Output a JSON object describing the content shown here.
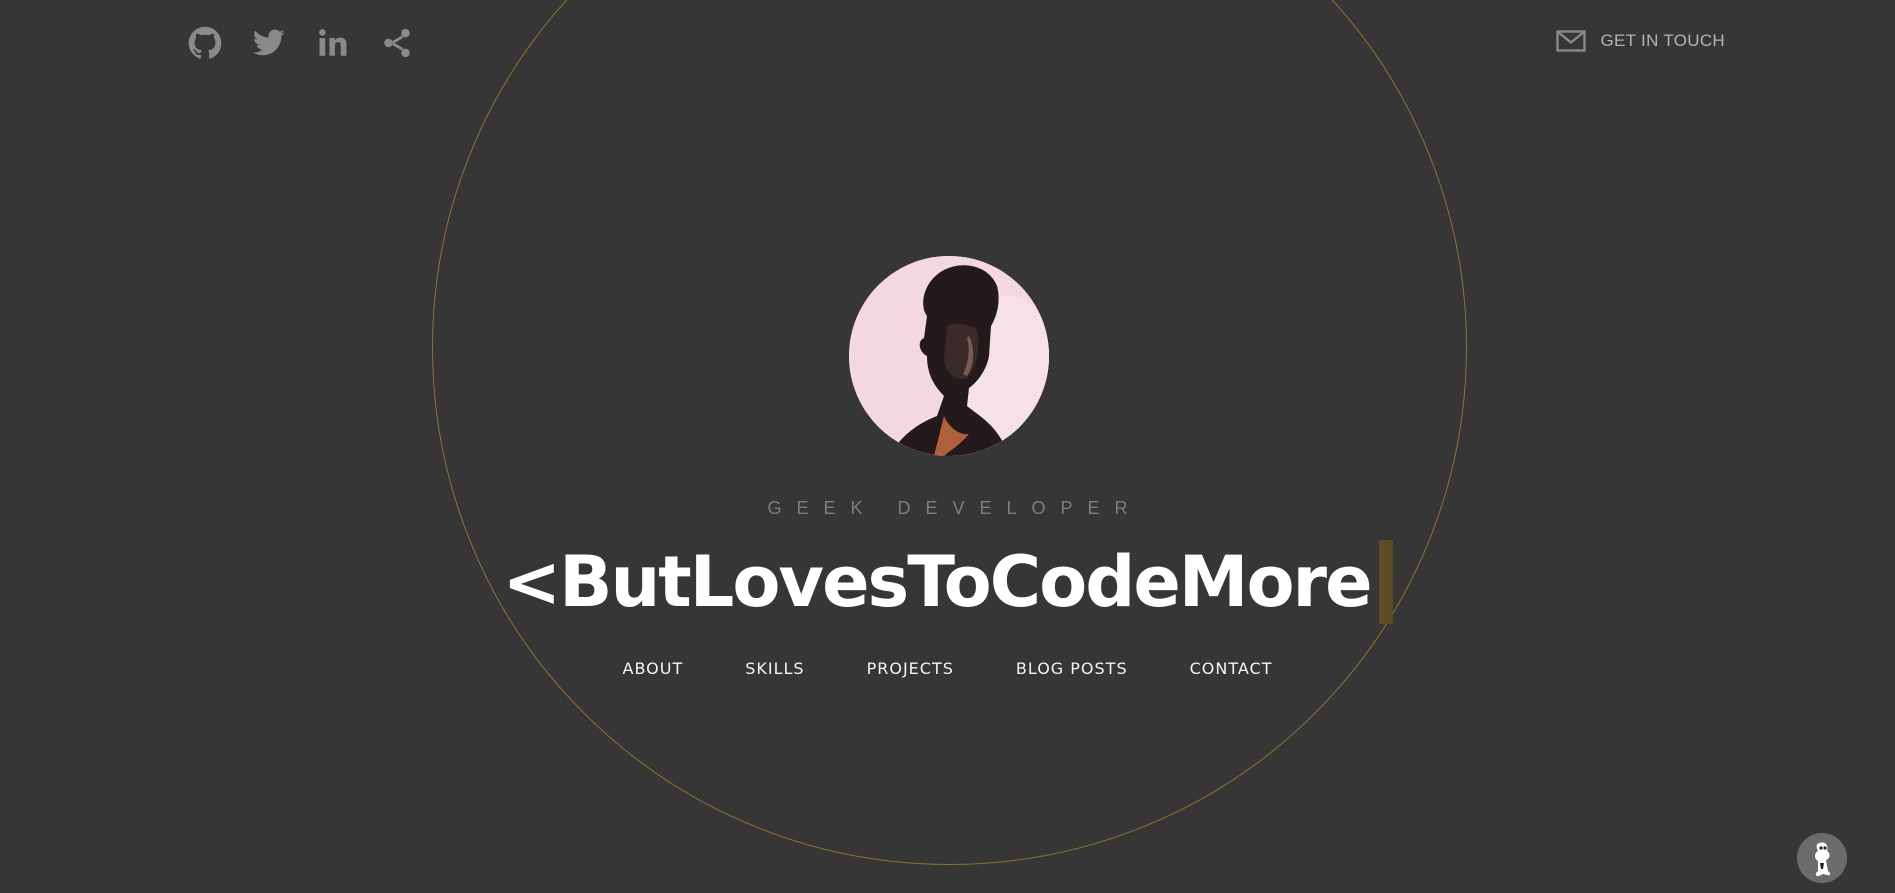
{
  "header": {
    "social_icons": [
      "github-icon",
      "twitter-icon",
      "linkedin-icon",
      "share-icon"
    ],
    "contact_link": {
      "icon": "mail-icon",
      "label": "GET IN TOUCH"
    }
  },
  "hero": {
    "avatar_alt": "profile photo",
    "subtitle": "GEEK DEVELOPER",
    "headline": "<ButLovesToCodeMore"
  },
  "nav": {
    "items": [
      {
        "label": "ABOUT"
      },
      {
        "label": "SKILLS"
      },
      {
        "label": "PROJECTS"
      },
      {
        "label": "BLOG POSTS"
      },
      {
        "label": "CONTACT"
      }
    ]
  },
  "colors": {
    "background": "#363636",
    "circle_outline": "#8f7232",
    "cursor": "#5e4a27",
    "subtitle": "#7d7d83",
    "icon": "#8a8a8a"
  }
}
